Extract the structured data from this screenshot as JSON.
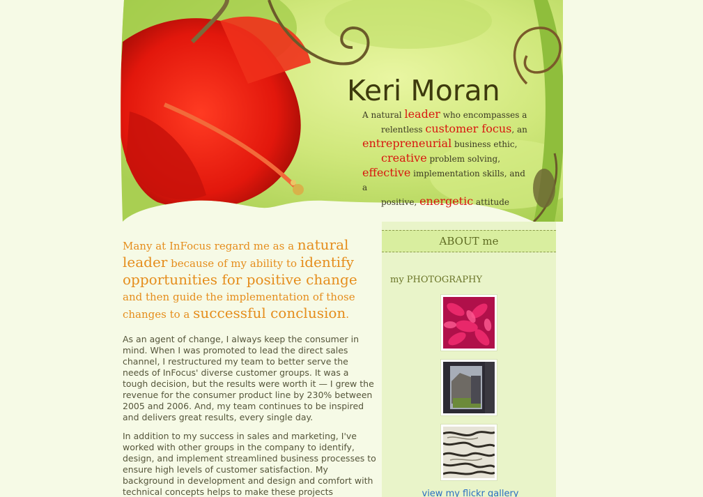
{
  "header": {
    "site_name": "Keri Moran",
    "tagline": {
      "t1": "A natural ",
      "h1": "leader",
      "t2": " who encompasses a",
      "t3": "relentless ",
      "h2": "customer focus",
      "t4": ", an",
      "h3": "entrepreneurial",
      "t5": " business ethic,",
      "h4": "creative",
      "t6": " problem solving,",
      "h5": "effective",
      "t7": " implementation skills, and a",
      "t8": "positive, ",
      "h6": "energetic",
      "t9": " attitude"
    }
  },
  "main": {
    "intro": {
      "p1": "Many at InFocus regard me as a ",
      "b1": "natural leader",
      "p2": " because of my ability to ",
      "b2": "identify opportunities for positive change",
      "p3": " and then guide the implementation of those changes to a ",
      "b3": "successful conclusion",
      "p4": "."
    },
    "paragraphs": [
      "As an agent of change, I always keep the consumer in mind. When I was promoted to lead the direct sales channel, I restructured my team to better serve the needs of InFocus' diverse customer groups. It was a tough decision, but the results were worth it —  I grew the revenue for the consumer product line by 230% between 2005 and 2006. And, my team continues to be inspired and delivers great results, every single day.",
      "In addition to my success in sales and marketing, I've worked with other groups in the company to identify, design, and implement streamlined business processes to ensure high levels of customer satisfaction. My background in development and design and comfort with technical concepts helps to make these projects"
    ]
  },
  "sidebar": {
    "about_label": "ABOUT me",
    "photography_heading": "my PHOTOGRAPHY",
    "flickr_link": "view my flickr gallery"
  },
  "colors": {
    "page_background": "#f6fae6",
    "sidebar_background": "#e9f4c9",
    "about_bar": "#d9ee9f",
    "intro_orange": "#e58d1c",
    "tagline_highlight": "#d8170f",
    "link_blue": "#2a6ec2"
  }
}
